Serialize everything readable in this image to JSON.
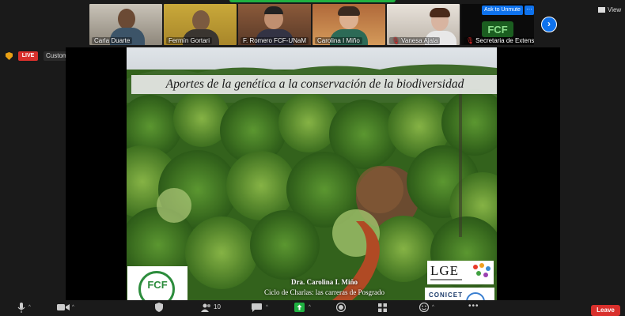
{
  "participants": [
    {
      "name": "Carla Duarte",
      "muted": false
    },
    {
      "name": "Fermín Gortari",
      "muted": false
    },
    {
      "name": "F. Romero FCF-UNaM",
      "muted": false
    },
    {
      "name": "Carolina I Miño",
      "muted": false
    },
    {
      "name": "Vanesa Ajala",
      "muted": true
    },
    {
      "name": "Secretaria de Extensi...",
      "muted": true
    }
  ],
  "controls": {
    "ask_to_unmute": "Ask to Unmute",
    "more": "···",
    "next_page": "›",
    "view_label": "View"
  },
  "live": {
    "badge": "LIVE",
    "service": "Custom Live Streaming Service"
  },
  "slide": {
    "title": "Aportes de la genética a la conservación de la biodiversidad",
    "logo_left": "FCF",
    "author": "Dra. Carolina I. Miño",
    "cycle": "Ciclo de Charlas: las carreras de Posgrado",
    "logo_right": "LGE",
    "logo_conicet": "CONICET",
    "tile_logo": "FCF"
  },
  "toolbar": {
    "participants_count": "10",
    "leave_label": "Leave"
  },
  "colors": {
    "accent": "#0e72ed",
    "live": "#d9302c",
    "active_speaker": "#f0e040",
    "share_green": "#1fb141"
  }
}
